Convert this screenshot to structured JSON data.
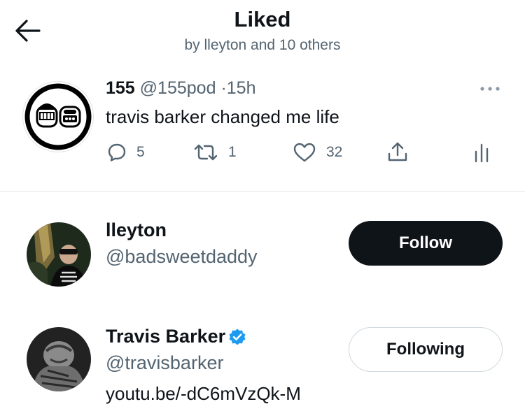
{
  "header": {
    "title": "Liked",
    "subtitle": "by lleyton and 10 others"
  },
  "tweet": {
    "name": "155",
    "handle": "@155pod",
    "separator": "·",
    "time": "15h",
    "text": "travis barker changed me life",
    "stats": {
      "replies": "5",
      "retweets": "1",
      "likes": "32"
    }
  },
  "users": [
    {
      "name": "lleyton",
      "handle": "@badsweetdaddy",
      "button_label": "Follow",
      "verified": false
    },
    {
      "name": "Travis Barker",
      "handle": "@travisbarker",
      "bio": "youtu.be/-dC6mVzQk-M",
      "button_label": "Following",
      "verified": true
    }
  ],
  "colors": {
    "text_primary": "#0f1419",
    "text_secondary": "#536471",
    "verified_blue": "#1d9bf0",
    "divider": "#e1e4e6"
  },
  "icons": [
    "back-arrow-icon",
    "more-icon",
    "reply-icon",
    "retweet-icon",
    "like-icon",
    "share-icon",
    "analytics-icon",
    "verified-badge-icon"
  ]
}
